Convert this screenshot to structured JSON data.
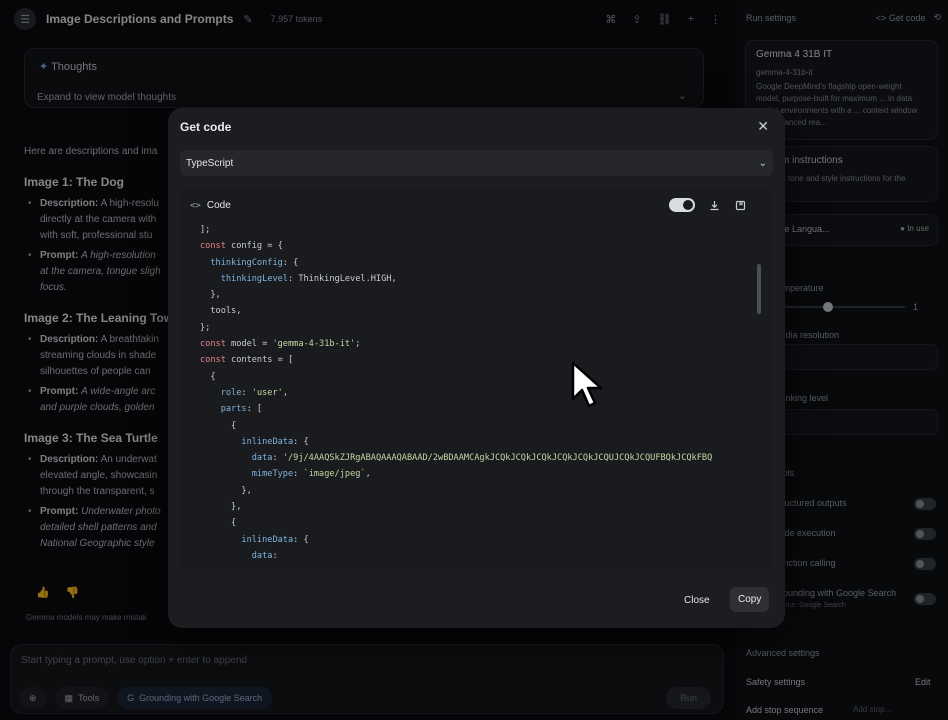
{
  "app": {
    "title": "Image Descriptions and Prompts",
    "tokens": "7,957 tokens"
  },
  "chat": {
    "thoughts_title": "Thoughts",
    "thoughts_expand": "Expand to view model thoughts",
    "intro": "Here are descriptions and ima",
    "images": [
      {
        "heading": "Image 1: The Dog",
        "desc_label": "Description:",
        "desc": "A high-resolu",
        "desc2": "directly at the camera with",
        "desc3": "with soft, professional stu",
        "prompt_label": "Prompt:",
        "prompt": "A high-resolution",
        "prompt2": "at the camera, tongue sligh",
        "prompt3": "focus."
      },
      {
        "heading": "Image 2: The Leaning Tow",
        "desc_label": "Description:",
        "desc": "A breathtakin",
        "desc2": "streaming clouds in shade",
        "desc3": "silhouettes of people can",
        "prompt_label": "Prompt:",
        "prompt": "A wide-angle arc",
        "prompt2": "and purple clouds, golden",
        "prompt3": ""
      },
      {
        "heading": "Image 3: The Sea Turtle",
        "desc_label": "Description:",
        "desc": "An underwat",
        "desc2": "elevated angle, showcasin",
        "desc3": "through the transparent, s",
        "prompt_label": "Prompt:",
        "prompt": "Underwater photo",
        "prompt2": "detailed shell patterns and",
        "prompt3": "National Geographic style"
      }
    ],
    "disclaimer": "Gemma models may make mistak",
    "prompt_placeholder": "Start typing a prompt, use option + enter to append",
    "tools_label": "Tools",
    "grounding_label": "Grounding with Google Search",
    "run_label": "Run"
  },
  "sidebar": {
    "run_settings": "Run settings",
    "get_code": "Get code",
    "model_name": "Gemma 4 31B IT",
    "model_id": "gemma-4-31b-it",
    "model_desc": "Google DeepMind's flagship open-weight model, purpose-built for maximum ... in data center environments with a ... context window and advanced rea...",
    "sys_title": "System instructions",
    "sys_sub": "Optional tone and style instructions for the model",
    "creative": "Creative Langua...",
    "in_use": "In use",
    "temperature": "Temperature",
    "temp_value": "1",
    "media_resolution": "Media resolution",
    "thinking_level": "Thinking level",
    "tools": "Tools",
    "structured": "Structured outputs",
    "code_exec": "Code execution",
    "func_calling": "Function calling",
    "grounding": "Grounding with Google Search",
    "grounding_src": "Source: Google Search",
    "edit": "Edit",
    "advanced": "Advanced settings",
    "safety": "Safety settings",
    "safety_edit": "Edit",
    "stop_seq": "Add stop sequence",
    "stop_ph": "Add stop..."
  },
  "modal": {
    "title": "Get code",
    "language": "TypeScript",
    "code_label": "Code",
    "close_label": "Close",
    "copy_label": "Copy",
    "code_lines": [
      [
        {
          "t": "];",
          "c": "plain"
        }
      ],
      [
        {
          "t": "const",
          "c": "kw"
        },
        {
          "t": " config = {",
          "c": "plain"
        }
      ],
      [
        {
          "t": "  ",
          "c": "plain"
        },
        {
          "t": "thinkingConfig",
          "c": "prop"
        },
        {
          "t": ": {",
          "c": "plain"
        }
      ],
      [
        {
          "t": "    ",
          "c": "plain"
        },
        {
          "t": "thinkingLevel",
          "c": "prop"
        },
        {
          "t": ": ThinkingLevel.HIGH,",
          "c": "plain"
        }
      ],
      [
        {
          "t": "  },",
          "c": "plain"
        }
      ],
      [
        {
          "t": "  tools,",
          "c": "plain"
        }
      ],
      [
        {
          "t": "};",
          "c": "plain"
        }
      ],
      [
        {
          "t": "const",
          "c": "kw"
        },
        {
          "t": " model = ",
          "c": "plain"
        },
        {
          "t": "'gemma-4-31b-it'",
          "c": "str"
        },
        {
          "t": ";",
          "c": "plain"
        }
      ],
      [
        {
          "t": "const",
          "c": "kw"
        },
        {
          "t": " contents = [",
          "c": "plain"
        }
      ],
      [
        {
          "t": "  {",
          "c": "plain"
        }
      ],
      [
        {
          "t": "    ",
          "c": "plain"
        },
        {
          "t": "role",
          "c": "prop"
        },
        {
          "t": ": ",
          "c": "plain"
        },
        {
          "t": "'user'",
          "c": "str"
        },
        {
          "t": ",",
          "c": "plain"
        }
      ],
      [
        {
          "t": "    ",
          "c": "plain"
        },
        {
          "t": "parts",
          "c": "prop"
        },
        {
          "t": ": [",
          "c": "plain"
        }
      ],
      [
        {
          "t": "      {",
          "c": "plain"
        }
      ],
      [
        {
          "t": "        ",
          "c": "plain"
        },
        {
          "t": "inlineData",
          "c": "prop"
        },
        {
          "t": ": {",
          "c": "plain"
        }
      ],
      [
        {
          "t": "          ",
          "c": "plain"
        },
        {
          "t": "data",
          "c": "prop"
        },
        {
          "t": ": ",
          "c": "plain"
        },
        {
          "t": "'/9j/4AAQSkZJRgABAQAAAQABAAD/2wBDAAMCAgkJCQkJCQkJCQkJCQkJCQkJCQUJCQkJCQUFBQkJCQkFBQ",
          "c": "str"
        }
      ],
      [
        {
          "t": "          ",
          "c": "plain"
        },
        {
          "t": "mimeType",
          "c": "prop"
        },
        {
          "t": ": ",
          "c": "plain"
        },
        {
          "t": "`image/jpeg`",
          "c": "str"
        },
        {
          "t": ",",
          "c": "plain"
        }
      ],
      [
        {
          "t": "        },",
          "c": "plain"
        }
      ],
      [
        {
          "t": "      },",
          "c": "plain"
        }
      ],
      [
        {
          "t": "      {",
          "c": "plain"
        }
      ],
      [
        {
          "t": "        ",
          "c": "plain"
        },
        {
          "t": "inlineData",
          "c": "prop"
        },
        {
          "t": ": {",
          "c": "plain"
        }
      ],
      [
        {
          "t": "          ",
          "c": "plain"
        },
        {
          "t": "data",
          "c": "prop"
        },
        {
          "t": ":",
          "c": "plain"
        }
      ]
    ]
  }
}
